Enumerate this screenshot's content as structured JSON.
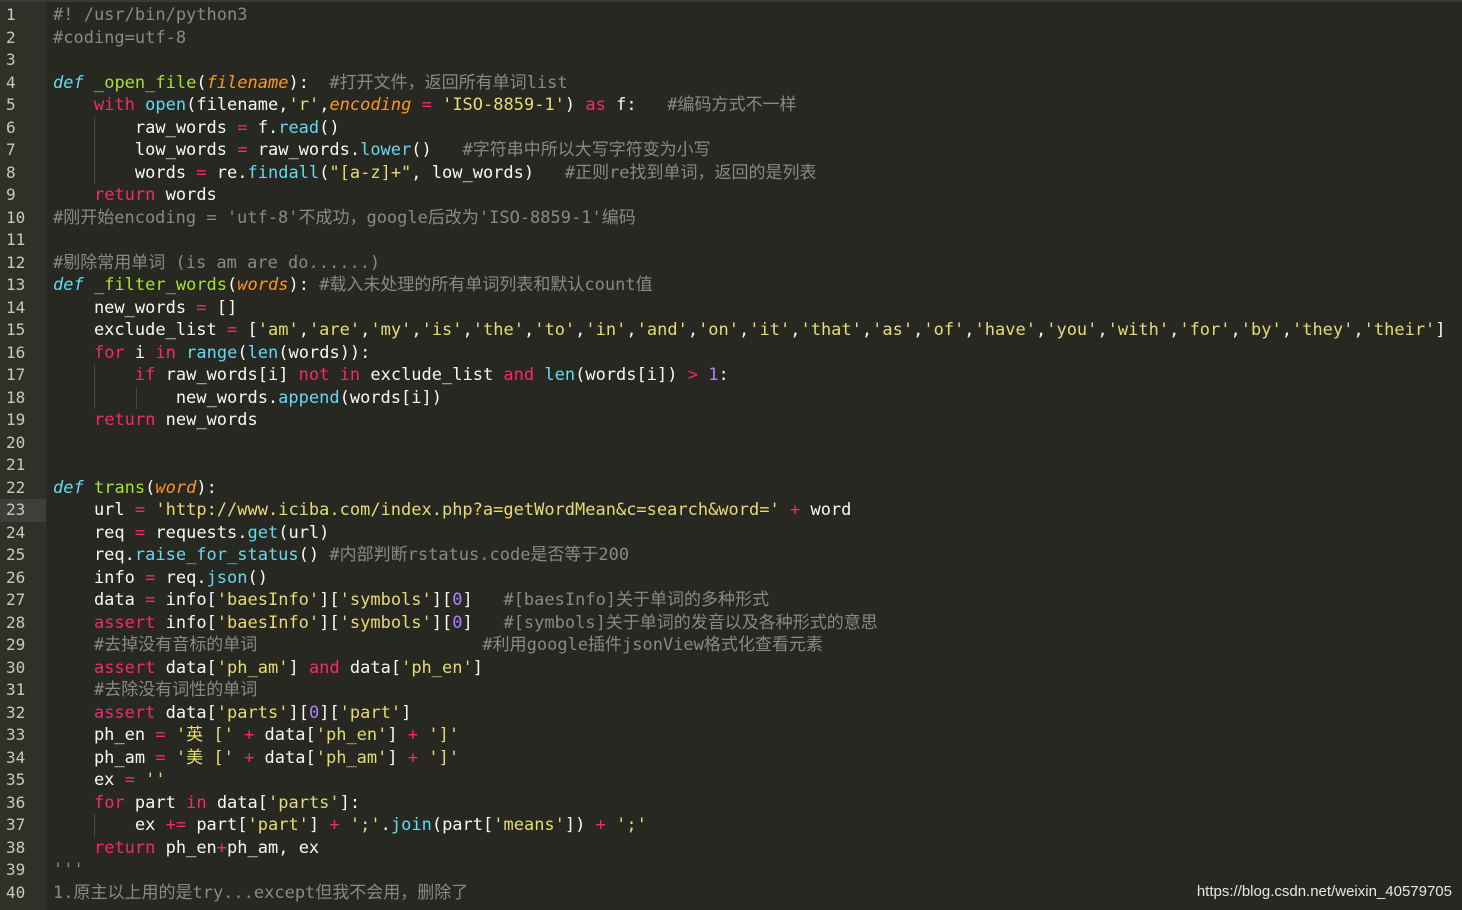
{
  "watermark": "https://blog.csdn.net/weixin_40579705",
  "active_line": 23,
  "lines": [
    [
      [
        "#! /usr/bin/python3",
        "cm"
      ]
    ],
    [
      [
        "#coding=utf-8",
        "cm"
      ]
    ],
    [],
    [
      [
        "def",
        "dk"
      ],
      [
        " ",
        ""
      ],
      [
        "_open_file",
        "fn"
      ],
      [
        "(",
        ""
      ],
      [
        "filename",
        "pa"
      ],
      [
        "):  ",
        ""
      ],
      [
        "#打开文件，返回所有单词list",
        "cm"
      ]
    ],
    [
      [
        "    ",
        ""
      ],
      [
        "with",
        "kw"
      ],
      [
        " ",
        ""
      ],
      [
        "open",
        "bi"
      ],
      [
        "(filename,",
        ""
      ],
      [
        "'r'",
        "st"
      ],
      [
        ",",
        ""
      ],
      [
        "encoding",
        "pa"
      ],
      [
        " ",
        ""
      ],
      [
        "=",
        "kw"
      ],
      [
        " ",
        ""
      ],
      [
        "'ISO-8859-1'",
        "st"
      ],
      [
        ") ",
        ""
      ],
      [
        "as",
        "kw"
      ],
      [
        " f:   ",
        ""
      ],
      [
        "#编码方式不一样",
        "cm"
      ]
    ],
    [
      [
        "        raw_words ",
        ""
      ],
      [
        "=",
        "kw"
      ],
      [
        " f.",
        ""
      ],
      [
        "read",
        "bi"
      ],
      [
        "()",
        ""
      ]
    ],
    [
      [
        "        low_words ",
        ""
      ],
      [
        "=",
        "kw"
      ],
      [
        " raw_words.",
        ""
      ],
      [
        "lower",
        "bi"
      ],
      [
        "()   ",
        ""
      ],
      [
        "#字符串中所以大写字符变为小写",
        "cm"
      ]
    ],
    [
      [
        "        words ",
        ""
      ],
      [
        "=",
        "kw"
      ],
      [
        " re.",
        ""
      ],
      [
        "findall",
        "bi"
      ],
      [
        "(",
        ""
      ],
      [
        "\"[a-z]+\"",
        "st"
      ],
      [
        ", low_words)   ",
        ""
      ],
      [
        "#正则re找到单词，返回的是列表",
        "cm"
      ]
    ],
    [
      [
        "    ",
        ""
      ],
      [
        "return",
        "kw"
      ],
      [
        " words",
        ""
      ]
    ],
    [
      [
        "#刚开始encoding = 'utf-8'不成功，google后改为'ISO-8859-1'编码",
        "cm"
      ]
    ],
    [],
    [
      [
        "#剔除常用单词 (is am are do......)",
        "cm"
      ]
    ],
    [
      [
        "def",
        "dk"
      ],
      [
        " ",
        ""
      ],
      [
        "_filter_words",
        "fn"
      ],
      [
        "(",
        ""
      ],
      [
        "words",
        "pa"
      ],
      [
        "): ",
        ""
      ],
      [
        "#载入未处理的所有单词列表和默认count值",
        "cm"
      ]
    ],
    [
      [
        "    new_words ",
        ""
      ],
      [
        "=",
        "kw"
      ],
      [
        " []",
        ""
      ]
    ],
    [
      [
        "    exclude_list ",
        ""
      ],
      [
        "=",
        "kw"
      ],
      [
        " [",
        ""
      ],
      [
        "'am'",
        "st"
      ],
      [
        ",",
        ""
      ],
      [
        "'are'",
        "st"
      ],
      [
        ",",
        ""
      ],
      [
        "'my'",
        "st"
      ],
      [
        ",",
        ""
      ],
      [
        "'is'",
        "st"
      ],
      [
        ",",
        ""
      ],
      [
        "'the'",
        "st"
      ],
      [
        ",",
        ""
      ],
      [
        "'to'",
        "st"
      ],
      [
        ",",
        ""
      ],
      [
        "'in'",
        "st"
      ],
      [
        ",",
        ""
      ],
      [
        "'and'",
        "st"
      ],
      [
        ",",
        ""
      ],
      [
        "'on'",
        "st"
      ],
      [
        ",",
        ""
      ],
      [
        "'it'",
        "st"
      ],
      [
        ",",
        ""
      ],
      [
        "'that'",
        "st"
      ],
      [
        ",",
        ""
      ],
      [
        "'as'",
        "st"
      ],
      [
        ",",
        ""
      ],
      [
        "'of'",
        "st"
      ],
      [
        ",",
        ""
      ],
      [
        "'have'",
        "st"
      ],
      [
        ",",
        ""
      ],
      [
        "'you'",
        "st"
      ],
      [
        ",",
        ""
      ],
      [
        "'with'",
        "st"
      ],
      [
        ",",
        ""
      ],
      [
        "'for'",
        "st"
      ],
      [
        ",",
        ""
      ],
      [
        "'by'",
        "st"
      ],
      [
        ",",
        ""
      ],
      [
        "'they'",
        "st"
      ],
      [
        ",",
        ""
      ],
      [
        "'their'",
        "st"
      ],
      [
        "]",
        ""
      ]
    ],
    [
      [
        "    ",
        ""
      ],
      [
        "for",
        "kw"
      ],
      [
        " i ",
        ""
      ],
      [
        "in",
        "kw"
      ],
      [
        " ",
        ""
      ],
      [
        "range",
        "bi"
      ],
      [
        "(",
        ""
      ],
      [
        "len",
        "bi"
      ],
      [
        "(words)):",
        ""
      ]
    ],
    [
      [
        "        ",
        ""
      ],
      [
        "if",
        "kw"
      ],
      [
        " raw_words[i] ",
        ""
      ],
      [
        "not",
        "kw"
      ],
      [
        " ",
        ""
      ],
      [
        "in",
        "kw"
      ],
      [
        " exclude_list ",
        ""
      ],
      [
        "and",
        "kw"
      ],
      [
        " ",
        ""
      ],
      [
        "len",
        "bi"
      ],
      [
        "(words[i]) ",
        ""
      ],
      [
        ">",
        "kw"
      ],
      [
        " ",
        ""
      ],
      [
        "1",
        "nm"
      ],
      [
        ":",
        ""
      ]
    ],
    [
      [
        "            new_words.",
        ""
      ],
      [
        "append",
        "bi"
      ],
      [
        "(words[i])",
        ""
      ]
    ],
    [
      [
        "    ",
        ""
      ],
      [
        "return",
        "kw"
      ],
      [
        " new_words",
        ""
      ]
    ],
    [],
    [],
    [
      [
        "def",
        "dk"
      ],
      [
        " ",
        ""
      ],
      [
        "trans",
        "fn"
      ],
      [
        "(",
        ""
      ],
      [
        "word",
        "pa"
      ],
      [
        "):",
        ""
      ]
    ],
    [
      [
        "    url ",
        ""
      ],
      [
        "=",
        "kw"
      ],
      [
        " ",
        ""
      ],
      [
        "'http://www.iciba.com/index.php?a=getWordMean&c=search&word='",
        "st"
      ],
      [
        " ",
        ""
      ],
      [
        "+",
        "kw"
      ],
      [
        " word",
        ""
      ]
    ],
    [
      [
        "    req ",
        ""
      ],
      [
        "=",
        "kw"
      ],
      [
        " requests.",
        ""
      ],
      [
        "get",
        "bi"
      ],
      [
        "(url)",
        ""
      ]
    ],
    [
      [
        "    req.",
        ""
      ],
      [
        "raise_for_status",
        "bi"
      ],
      [
        "() ",
        ""
      ],
      [
        "#内部判断rstatus.code是否等于200",
        "cm"
      ]
    ],
    [
      [
        "    info ",
        ""
      ],
      [
        "=",
        "kw"
      ],
      [
        " req.",
        ""
      ],
      [
        "json",
        "bi"
      ],
      [
        "()",
        ""
      ]
    ],
    [
      [
        "    data ",
        ""
      ],
      [
        "=",
        "kw"
      ],
      [
        " info[",
        ""
      ],
      [
        "'baesInfo'",
        "st"
      ],
      [
        "][",
        ""
      ],
      [
        "'symbols'",
        "st"
      ],
      [
        "][",
        ""
      ],
      [
        "0",
        "nm"
      ],
      [
        "]   ",
        ""
      ],
      [
        "#[baesInfo]关于单词的多种形式",
        "cm"
      ]
    ],
    [
      [
        "    ",
        ""
      ],
      [
        "assert",
        "kw"
      ],
      [
        " info[",
        ""
      ],
      [
        "'baesInfo'",
        "st"
      ],
      [
        "][",
        ""
      ],
      [
        "'symbols'",
        "st"
      ],
      [
        "][",
        ""
      ],
      [
        "0",
        "nm"
      ],
      [
        "]   ",
        ""
      ],
      [
        "#[symbols]关于单词的发音以及各种形式的意思",
        "cm"
      ]
    ],
    [
      [
        "    ",
        ""
      ],
      [
        "#去掉没有音标的单词",
        "cm"
      ],
      [
        "                      ",
        ""
      ],
      [
        "#利用google插件jsonView格式化查看元素",
        "cm"
      ]
    ],
    [
      [
        "    ",
        ""
      ],
      [
        "assert",
        "kw"
      ],
      [
        " data[",
        ""
      ],
      [
        "'ph_am'",
        "st"
      ],
      [
        "] ",
        ""
      ],
      [
        "and",
        "kw"
      ],
      [
        " data[",
        ""
      ],
      [
        "'ph_en'",
        "st"
      ],
      [
        "]",
        ""
      ]
    ],
    [
      [
        "    ",
        ""
      ],
      [
        "#去除没有词性的单词",
        "cm"
      ]
    ],
    [
      [
        "    ",
        ""
      ],
      [
        "assert",
        "kw"
      ],
      [
        " data[",
        ""
      ],
      [
        "'parts'",
        "st"
      ],
      [
        "][",
        ""
      ],
      [
        "0",
        "nm"
      ],
      [
        "][",
        ""
      ],
      [
        "'part'",
        "st"
      ],
      [
        "]",
        ""
      ]
    ],
    [
      [
        "    ph_en ",
        ""
      ],
      [
        "=",
        "kw"
      ],
      [
        " ",
        ""
      ],
      [
        "'英 ['",
        "st"
      ],
      [
        " ",
        ""
      ],
      [
        "+",
        "kw"
      ],
      [
        " data[",
        ""
      ],
      [
        "'ph_en'",
        "st"
      ],
      [
        "] ",
        ""
      ],
      [
        "+",
        "kw"
      ],
      [
        " ",
        ""
      ],
      [
        "']'",
        "st"
      ]
    ],
    [
      [
        "    ph_am ",
        ""
      ],
      [
        "=",
        "kw"
      ],
      [
        " ",
        ""
      ],
      [
        "'美 ['",
        "st"
      ],
      [
        " ",
        ""
      ],
      [
        "+",
        "kw"
      ],
      [
        " data[",
        ""
      ],
      [
        "'ph_am'",
        "st"
      ],
      [
        "] ",
        ""
      ],
      [
        "+",
        "kw"
      ],
      [
        " ",
        ""
      ],
      [
        "']'",
        "st"
      ]
    ],
    [
      [
        "    ex ",
        ""
      ],
      [
        "=",
        "kw"
      ],
      [
        " ",
        ""
      ],
      [
        "''",
        "st"
      ]
    ],
    [
      [
        "    ",
        ""
      ],
      [
        "for",
        "kw"
      ],
      [
        " part ",
        ""
      ],
      [
        "in",
        "kw"
      ],
      [
        " data[",
        ""
      ],
      [
        "'parts'",
        "st"
      ],
      [
        "]:",
        ""
      ]
    ],
    [
      [
        "        ex ",
        ""
      ],
      [
        "+=",
        "kw"
      ],
      [
        " part[",
        ""
      ],
      [
        "'part'",
        "st"
      ],
      [
        "] ",
        ""
      ],
      [
        "+",
        "kw"
      ],
      [
        " ",
        ""
      ],
      [
        "';'",
        "st"
      ],
      [
        ".",
        ""
      ],
      [
        "join",
        "bi"
      ],
      [
        "(part[",
        ""
      ],
      [
        "'means'",
        "st"
      ],
      [
        "]) ",
        ""
      ],
      [
        "+",
        "kw"
      ],
      [
        " ",
        ""
      ],
      [
        "';'",
        "st"
      ]
    ],
    [
      [
        "    ",
        ""
      ],
      [
        "return",
        "kw"
      ],
      [
        " ph_en",
        ""
      ],
      [
        "+",
        "kw"
      ],
      [
        "ph_am, ex",
        ""
      ]
    ],
    [
      [
        "'''",
        "cm"
      ]
    ],
    [
      [
        "1.原主以上用的是try...except但我不会用，删除了",
        "cm"
      ]
    ]
  ]
}
